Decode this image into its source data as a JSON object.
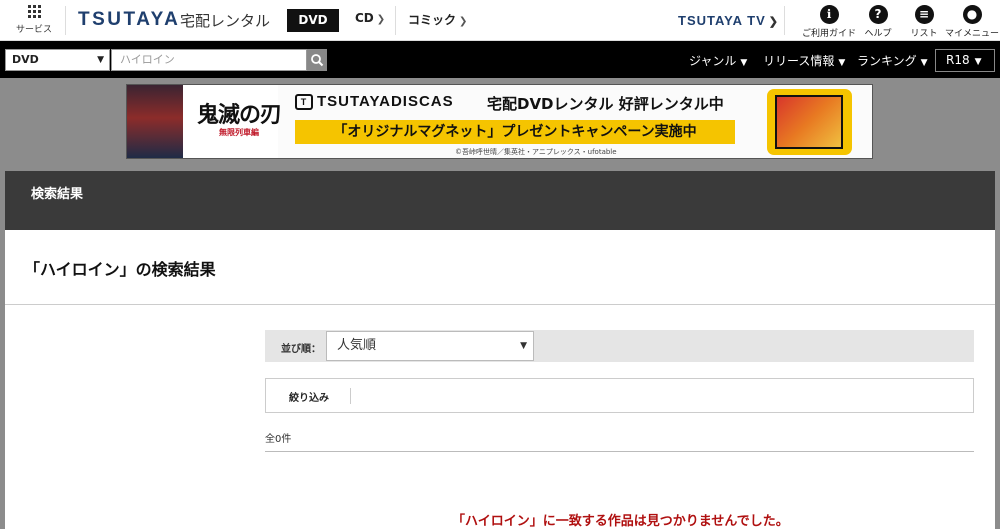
{
  "header": {
    "services_label": "サービス",
    "logo": "TSUTAYA",
    "logo_sub": "宅配レンタル",
    "tabs": [
      {
        "label": "DVD",
        "active": true
      },
      {
        "label": "CD"
      },
      {
        "label": "コミック"
      }
    ],
    "tv_link": "TSUTAYA TV",
    "icons": [
      {
        "icon": "guide-icon",
        "glyph": "ℹ",
        "label": "ご利用ガイド"
      },
      {
        "icon": "help-icon",
        "glyph": "?",
        "label": "ヘルプ"
      },
      {
        "icon": "list-icon",
        "glyph": "≡",
        "label": "リスト"
      },
      {
        "icon": "user-icon",
        "glyph": "●",
        "label": "マイメニュー"
      }
    ]
  },
  "search": {
    "category": "DVD",
    "query": "ハイロイン",
    "nav": [
      "ジャンル",
      "リリース情報",
      "ランキング"
    ],
    "r18": "R18"
  },
  "banner": {
    "title": "鬼滅の刃",
    "subtitle": "無限列車編",
    "discas": "TSUTAYADISCAS",
    "rental_text": "宅配DVDレンタル 好評レンタル中",
    "campaign": "「オリジナルマグネット」プレゼントキャンペーン実施中",
    "copyright": "©吾峠呼世晴／集英社・アニプレックス・ufotable"
  },
  "results": {
    "header": "検索結果",
    "title": "「ハイロイン」の検索結果",
    "sort_label": "並び順：",
    "sort_value": "人気順",
    "filter_label": "絞り込み",
    "count": "全0件",
    "no_results": "「ハイロイン」に一致する作品は見つかりませんでした。"
  },
  "colors": {
    "brand": "#1f3f6e",
    "campaign_yellow": "#f5c400",
    "error_red": "#b01010"
  }
}
